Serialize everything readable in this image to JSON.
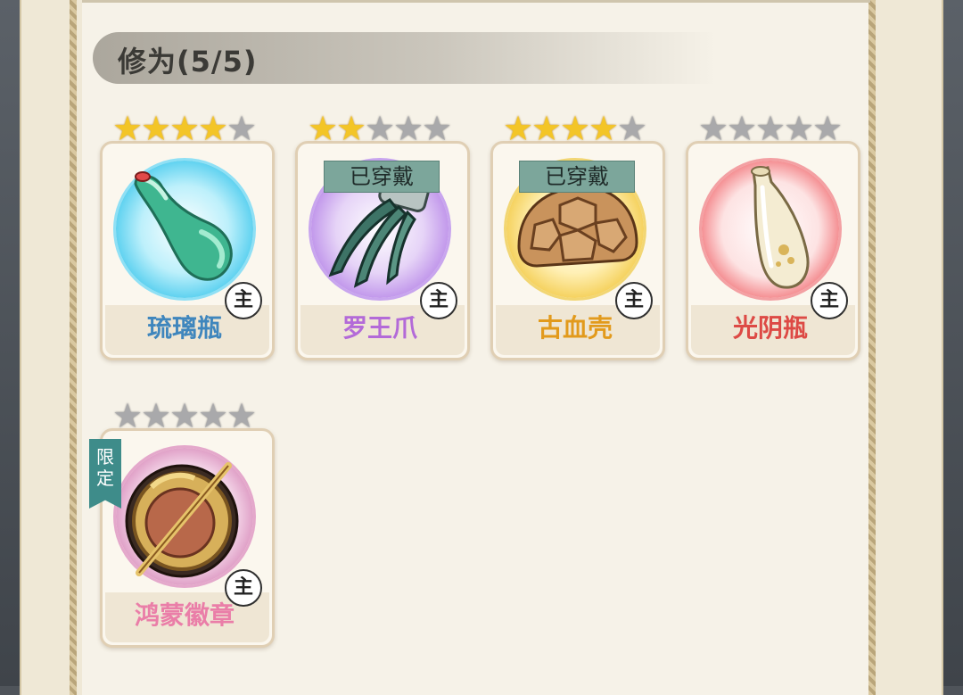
{
  "section": {
    "title": "修为(5/5)"
  },
  "labels": {
    "equipped": "已穿戴",
    "main": "主",
    "limited": "限定"
  },
  "items": [
    {
      "name": "琉璃瓶",
      "stars": 4,
      "max_stars": 5,
      "equipped": false,
      "limited": false,
      "name_color": "#3f86bd",
      "orb_color": "#3ec7ec",
      "icon": "glass-gourd-bottle-icon"
    },
    {
      "name": "罗王爪",
      "stars": 2,
      "max_stars": 5,
      "equipped": true,
      "limited": false,
      "name_color": "#b36ad8",
      "orb_color": "#b27ee6",
      "icon": "claw-gauntlet-icon"
    },
    {
      "name": "古血壳",
      "stars": 4,
      "max_stars": 5,
      "equipped": true,
      "limited": false,
      "name_color": "#e29a1c",
      "orb_color": "#f1c53a",
      "icon": "turtle-shell-icon"
    },
    {
      "name": "光阴瓶",
      "stars": 0,
      "max_stars": 5,
      "equipped": false,
      "limited": false,
      "name_color": "#dd4a45",
      "orb_color": "#ef5a60",
      "icon": "porcelain-vase-icon"
    },
    {
      "name": "鸿蒙徽章",
      "stars": 0,
      "max_stars": 5,
      "equipped": false,
      "limited": true,
      "name_color": "#ea7ea8",
      "orb_color": "#d27bb0",
      "icon": "golden-badge-icon"
    }
  ]
}
